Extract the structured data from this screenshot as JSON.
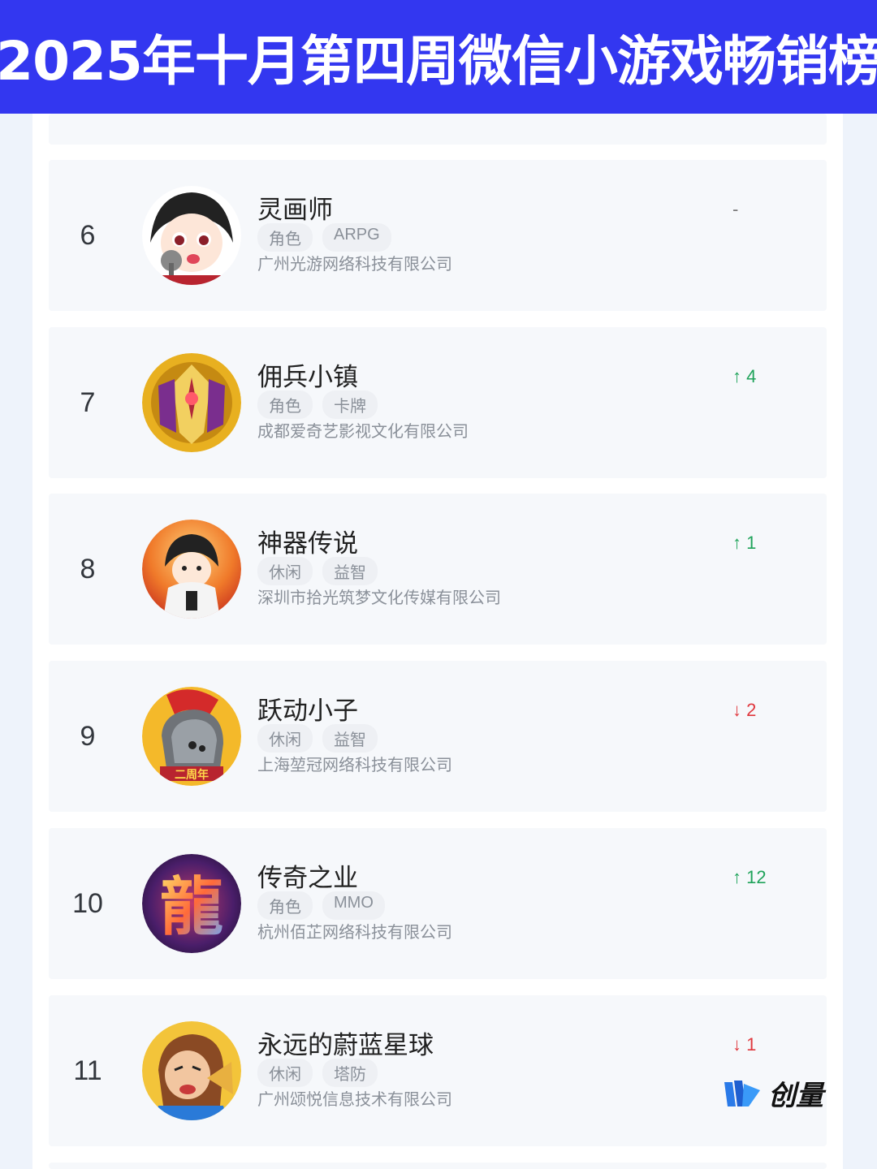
{
  "header": {
    "title": "2025年十月第四周微信小游戏畅销榜"
  },
  "games": [
    {
      "rank": "6",
      "name": "灵画师",
      "tags": [
        "角色",
        "ARPG"
      ],
      "company": "广州光游网络科技有限公司",
      "change": "-",
      "direction": "same"
    },
    {
      "rank": "7",
      "name": "佣兵小镇",
      "tags": [
        "角色",
        "卡牌"
      ],
      "company": "成都爱奇艺影视文化有限公司",
      "change": "↑ 4",
      "direction": "up"
    },
    {
      "rank": "8",
      "name": "神器传说",
      "tags": [
        "休闲",
        "益智"
      ],
      "company": "深圳市拾光筑梦文化传媒有限公司",
      "change": "↑ 1",
      "direction": "up"
    },
    {
      "rank": "9",
      "name": "跃动小子",
      "tags": [
        "休闲",
        "益智"
      ],
      "company": "上海堃冠网络科技有限公司",
      "change": "↓ 2",
      "direction": "down"
    },
    {
      "rank": "10",
      "name": "传奇之业",
      "tags": [
        "角色",
        "MMO"
      ],
      "company": "杭州佰芷网络科技有限公司",
      "change": "↑ 12",
      "direction": "up"
    },
    {
      "rank": "11",
      "name": "永远的蔚蓝星球",
      "tags": [
        "休闲",
        "塔防"
      ],
      "company": "广州颂悦信息技术有限公司",
      "change": "↓ 1",
      "direction": "down"
    }
  ],
  "watermark": {
    "text": "创量"
  },
  "colors": {
    "header_bg": "#3337f0",
    "up": "#1fa35a",
    "down": "#e0383e"
  }
}
